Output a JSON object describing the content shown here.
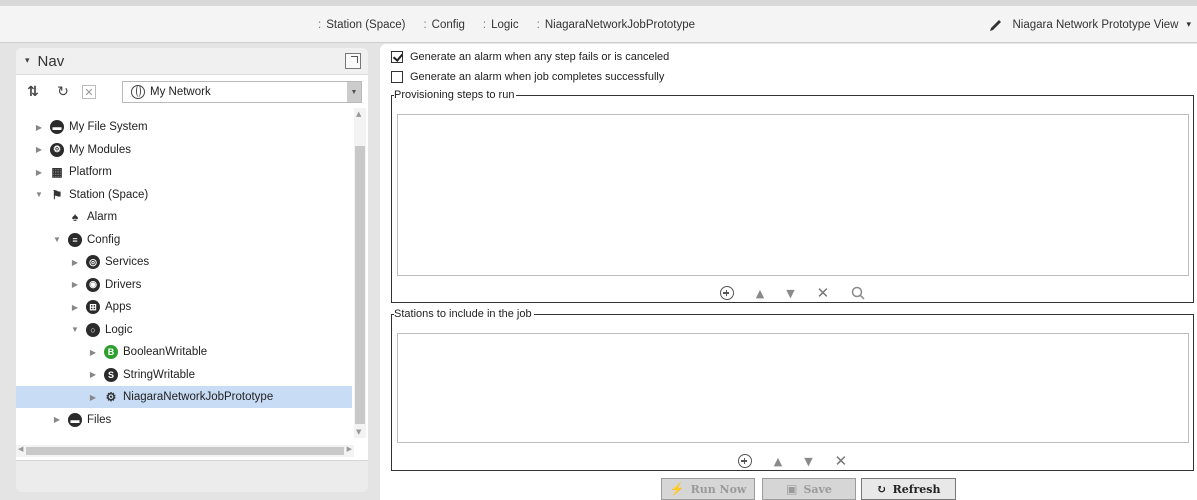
{
  "breadcrumbs": [
    {
      "sep": ":",
      "label": "Station (Space)"
    },
    {
      "sep": ":",
      "label": "Config"
    },
    {
      "sep": ":",
      "label": "Logic"
    },
    {
      "sep": ":",
      "label": "NiagaraNetworkJobPrototype"
    }
  ],
  "view_selector": {
    "label": "Niagara Network Prototype View",
    "caret": "▾",
    "icon": "pencil-icon"
  },
  "nav": {
    "title": "Nav",
    "network_selector": "My Network",
    "tree": [
      {
        "label": "My File System",
        "icon": "drive-icon",
        "glyph": "▬",
        "twisty": "▶",
        "level": 1
      },
      {
        "label": "My Modules",
        "icon": "modules-icon",
        "glyph": "⚙",
        "twisty": "▶",
        "level": 1
      },
      {
        "label": "Platform",
        "icon": "platform-icon",
        "glyph": "▦",
        "twisty": "▶",
        "level": 1
      },
      {
        "label": "Station (Space)",
        "icon": "station-icon",
        "glyph": "⚑",
        "twisty": "▼",
        "level": 1
      },
      {
        "label": "Alarm",
        "icon": "bell-icon",
        "glyph": "♠",
        "twisty": "",
        "level": 2
      },
      {
        "label": "Config",
        "icon": "config-icon",
        "glyph": "≡",
        "twisty": "▼",
        "level": 2
      },
      {
        "label": "Services",
        "icon": "services-icon",
        "glyph": "◎",
        "twisty": "▶",
        "level": 3
      },
      {
        "label": "Drivers",
        "icon": "drivers-icon",
        "glyph": "◉",
        "twisty": "▶",
        "level": 3
      },
      {
        "label": "Apps",
        "icon": "apps-icon",
        "glyph": "⊞",
        "twisty": "▶",
        "level": 3
      },
      {
        "label": "Logic",
        "icon": "logic-icon",
        "glyph": "○",
        "twisty": "▼",
        "level": 3
      },
      {
        "label": "BooleanWritable",
        "icon": "boolean-writable-icon",
        "glyph": "B",
        "twisty": "▶",
        "level": 4
      },
      {
        "label": "StringWritable",
        "icon": "string-writable-icon",
        "glyph": "S",
        "twisty": "▶",
        "level": 4
      },
      {
        "label": "NiagaraNetworkJobPrototype",
        "icon": "job-prototype-icon",
        "glyph": "⚙",
        "twisty": "▶",
        "level": 4,
        "selected": true
      },
      {
        "label": "Files",
        "icon": "files-icon",
        "glyph": "▬",
        "twisty": "▶",
        "level": 2
      }
    ]
  },
  "options": {
    "alarm_on_failure": {
      "label": "Generate an alarm when any step fails or is canceled",
      "checked": true
    },
    "alarm_on_success": {
      "label": "Generate an alarm when job completes successfully",
      "checked": false
    }
  },
  "provisioning": {
    "legend": "Provisioning steps to run"
  },
  "stations": {
    "legend": "Stations to include in the job"
  },
  "buttons": {
    "run_now": {
      "label": "Run Now",
      "enabled": false
    },
    "save": {
      "label": "Save",
      "enabled": false
    },
    "refresh": {
      "label": "Refresh",
      "enabled": true
    }
  }
}
